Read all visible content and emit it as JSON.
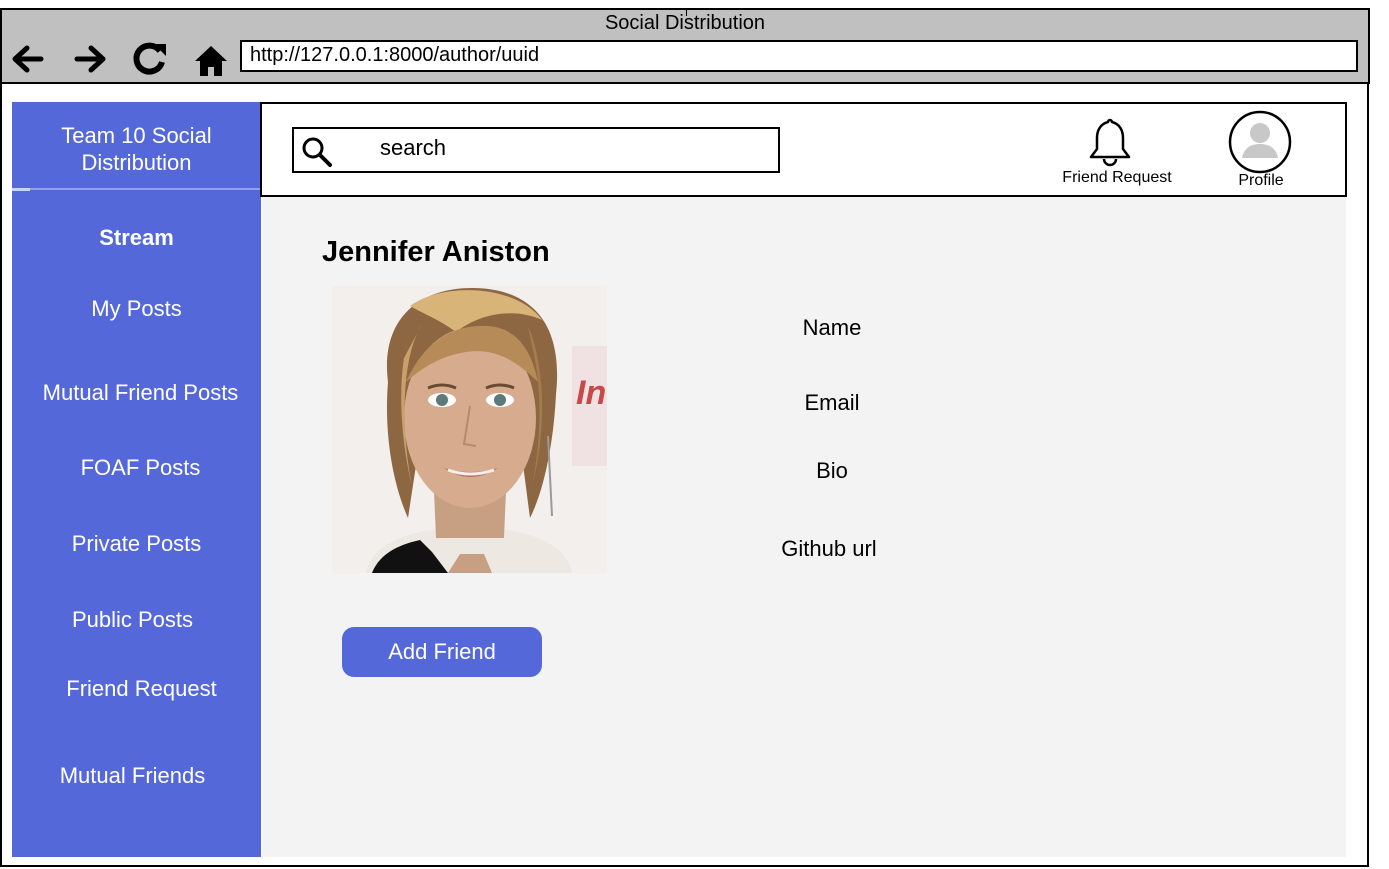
{
  "window": {
    "title": "Social Distribution"
  },
  "browser": {
    "url": "http://127.0.0.1:8000/author/uuid"
  },
  "sidebar": {
    "brand": "Team 10 Social Distribution",
    "items": [
      {
        "label": "Stream",
        "active": true
      },
      {
        "label": "My Posts"
      },
      {
        "label": "Mutual Friend Posts"
      },
      {
        "label": "FOAF Posts"
      },
      {
        "label": "Private Posts"
      },
      {
        "label": "Public Posts"
      },
      {
        "label": "Friend Request"
      },
      {
        "label": "Mutual Friends"
      }
    ]
  },
  "header": {
    "search_placeholder": "search",
    "friend_request_label": "Friend Request",
    "profile_label": "Profile"
  },
  "profile": {
    "name": "Jennifer Aniston",
    "fields": [
      "Name",
      "Email",
      "Bio",
      "Github url"
    ],
    "add_friend_label": "Add Friend"
  },
  "icons": {
    "back": "arrow-left-icon",
    "forward": "arrow-right-icon",
    "refresh": "refresh-icon",
    "home": "home-icon",
    "search": "search-icon",
    "bell": "bell-icon",
    "avatar": "avatar-icon"
  },
  "colors": {
    "accent": "#5468d9",
    "content_bg": "#f3f3f3",
    "titlebar": "#c0c0c0"
  }
}
